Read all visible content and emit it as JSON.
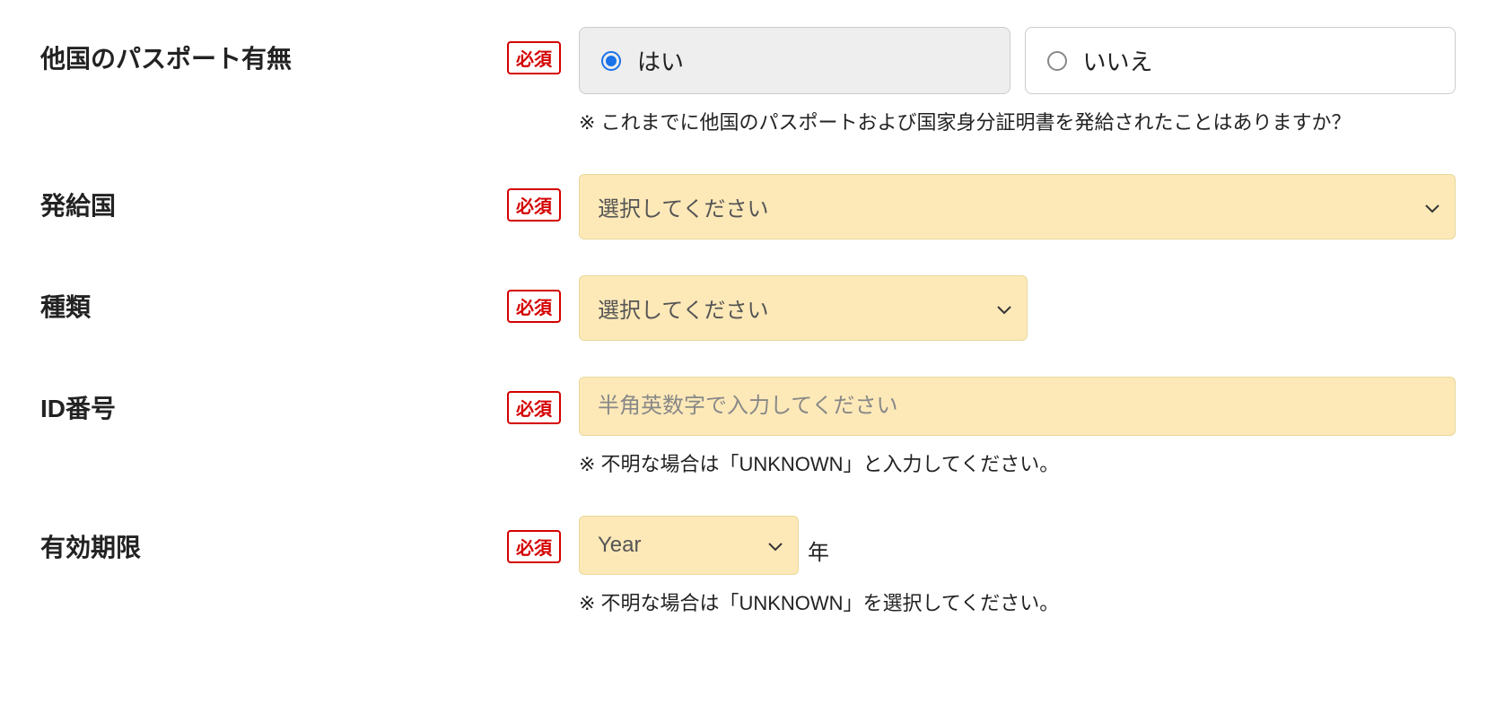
{
  "required_label": "必須",
  "fields": {
    "other_passport": {
      "label": "他国のパスポート有無",
      "option_yes": "はい",
      "option_no": "いいえ",
      "help": "これまでに他国のパスポートおよび国家身分証明書を発給されたことはありますか？"
    },
    "issuing_country": {
      "label": "発給国",
      "placeholder": "選択してください"
    },
    "doc_type": {
      "label": "種類",
      "placeholder": "選択してください"
    },
    "id_number": {
      "label": "ID番号",
      "placeholder": "半角英数字で入力してください",
      "help": "不明な場合は「UNKNOWN」と入力してください。"
    },
    "expiry": {
      "label": "有効期限",
      "year_placeholder": "Year",
      "year_unit": "年",
      "help": "不明な場合は「UNKNOWN」を選択してください。"
    }
  },
  "asterisk": "※"
}
